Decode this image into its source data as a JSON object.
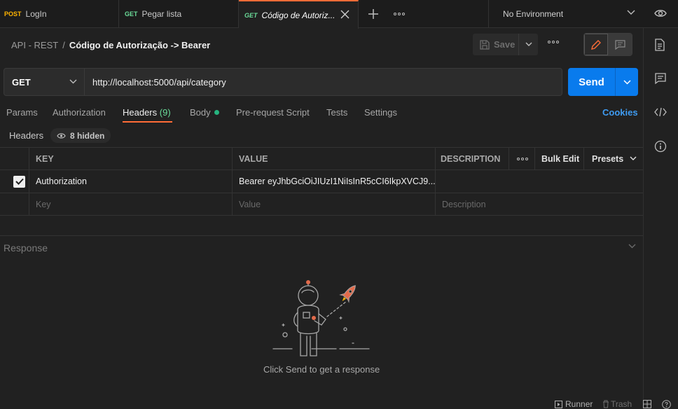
{
  "tabs": [
    {
      "method": "POST",
      "label": "LogIn"
    },
    {
      "method": "GET",
      "label": "Pegar lista"
    },
    {
      "method": "GET",
      "label": "Código de Autoriz..."
    }
  ],
  "environment": "No Environment",
  "breadcrumb": {
    "collection": "API - REST",
    "separator": "/",
    "request": "Código de Autorização -> Bearer"
  },
  "save_label": "Save",
  "request": {
    "method": "GET",
    "url": "http://localhost:5000/api/category"
  },
  "send_label": "Send",
  "request_tabs": {
    "params": "Params",
    "authorization": "Authorization",
    "headers": "Headers",
    "headers_count": "(9)",
    "body": "Body",
    "prerequest": "Pre-request Script",
    "tests": "Tests",
    "settings": "Settings"
  },
  "cookies": "Cookies",
  "headers_section": {
    "label": "Headers",
    "hidden": "8 hidden"
  },
  "table": {
    "columns": {
      "key": "KEY",
      "value": "VALUE",
      "description": "DESCRIPTION",
      "bulk_edit": "Bulk Edit",
      "presets": "Presets"
    },
    "rows": [
      {
        "key": "Authorization",
        "value": "Bearer eyJhbGciOiJIUzI1NiIsInR5cCI6IkpXVCJ9..."
      }
    ],
    "placeholders": {
      "key": "Key",
      "value": "Value",
      "description": "Description"
    }
  },
  "response": {
    "label": "Response",
    "hint": "Click Send to get a response"
  },
  "footer": {
    "runner": "Runner",
    "trash": "Trash"
  },
  "colors": {
    "accent": "#ff6c37",
    "send": "#097bed",
    "post": "#ffb400",
    "get": "#6bdd9a",
    "link": "#3f9cf2"
  }
}
